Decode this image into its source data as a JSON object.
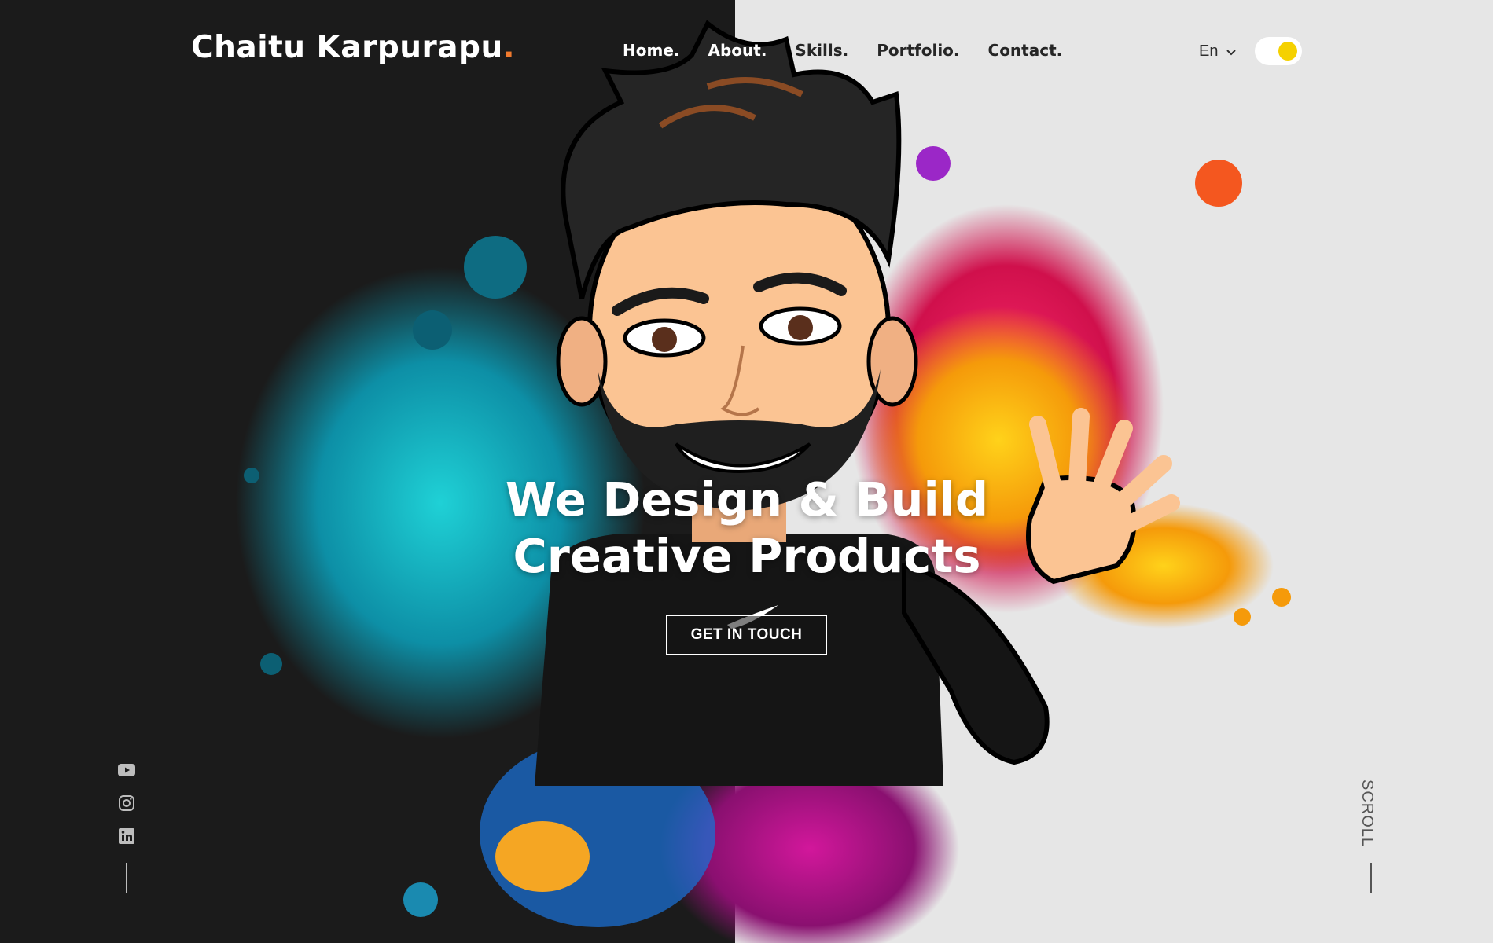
{
  "brand": {
    "name": "Chaitu Karpurapu",
    "dot": "."
  },
  "nav": [
    {
      "label": "Home."
    },
    {
      "label": "About."
    },
    {
      "label": "Skills."
    },
    {
      "label": "Portfolio."
    },
    {
      "label": "Contact."
    }
  ],
  "language": {
    "selected": "En"
  },
  "theme_toggle": {
    "state": "on",
    "knob_color": "#f5d100"
  },
  "hero": {
    "title_line1": "We Design & Build",
    "title_line2": "Creative Products",
    "cta_label": "GET IN TOUCH"
  },
  "social": [
    {
      "icon": "youtube-icon"
    },
    {
      "icon": "instagram-icon"
    },
    {
      "icon": "linkedin-icon"
    }
  ],
  "scroll_label": "SCROLL",
  "colors": {
    "dark_bg": "#1b1b1b",
    "light_bg": "#e6e6e6",
    "accent": "#f07a2e"
  }
}
